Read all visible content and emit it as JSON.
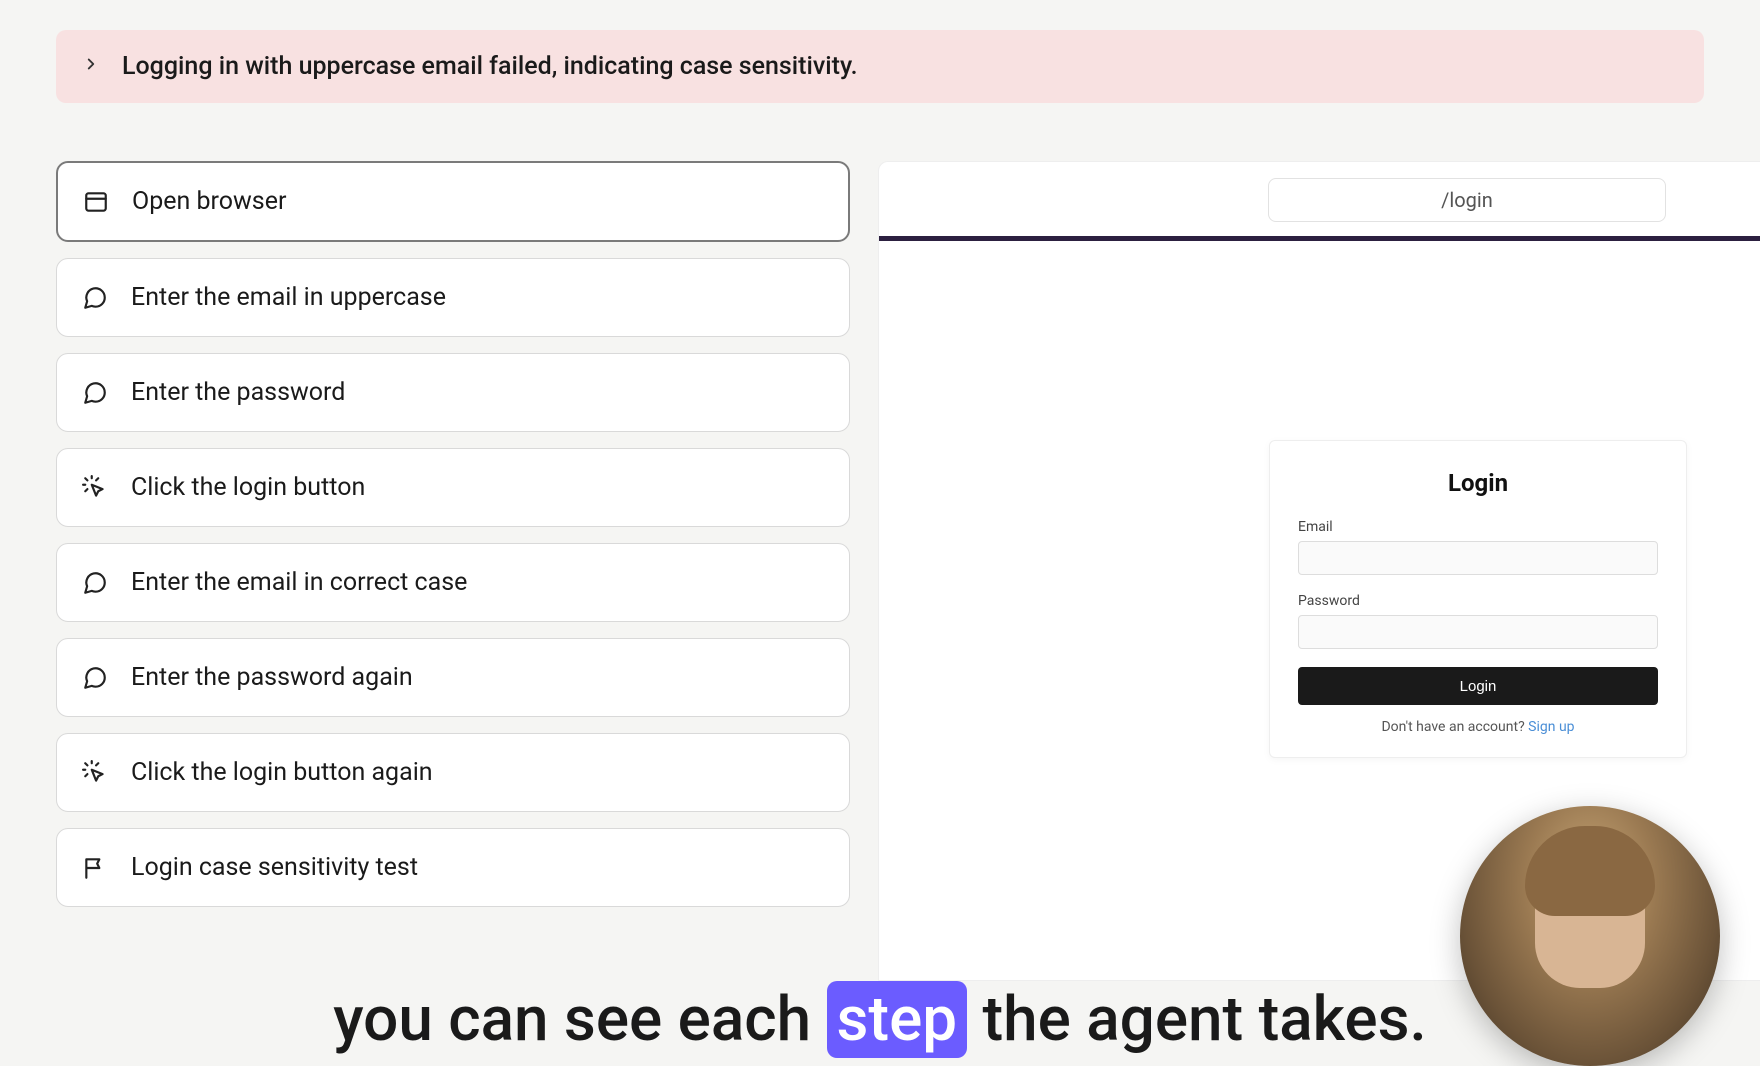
{
  "alert": {
    "message": "Logging in with uppercase email failed, indicating case sensitivity."
  },
  "steps": [
    {
      "icon": "browser",
      "label": "Open browser",
      "selected": true
    },
    {
      "icon": "comment",
      "label": "Enter the email in uppercase",
      "selected": false
    },
    {
      "icon": "comment",
      "label": "Enter the password",
      "selected": false
    },
    {
      "icon": "click",
      "label": "Click the login button",
      "selected": false
    },
    {
      "icon": "comment",
      "label": "Enter the email in correct case",
      "selected": false
    },
    {
      "icon": "comment",
      "label": "Enter the password again",
      "selected": false
    },
    {
      "icon": "click",
      "label": "Click the login button again",
      "selected": false
    },
    {
      "icon": "flag",
      "label": "Login case sensitivity test",
      "selected": false
    }
  ],
  "preview": {
    "url": "/login",
    "login_form": {
      "title": "Login",
      "email_label": "Email",
      "password_label": "Password",
      "button_label": "Login",
      "signup_prompt": "Don't have an account? ",
      "signup_link": "Sign up"
    }
  },
  "caption": {
    "before": "you can see each ",
    "highlight": "step",
    "after": " the agent takes."
  }
}
